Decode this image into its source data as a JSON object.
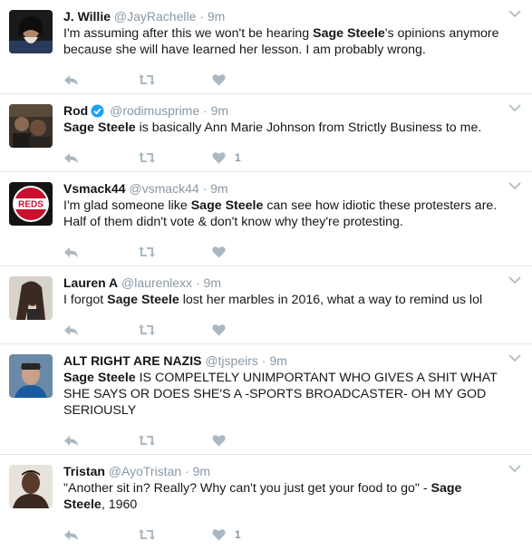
{
  "tweets": [
    {
      "name": "J. Willie",
      "handle": "@JayRachelle",
      "time": "9m",
      "verified": false,
      "text_parts": [
        {
          "t": "I'm assuming after this we won't be hearing ",
          "b": false
        },
        {
          "t": "Sage Steele",
          "b": true
        },
        {
          "t": "'s opinions anymore because she will have learned her lesson. I am probably wrong.",
          "b": false
        }
      ],
      "likes": ""
    },
    {
      "name": "Rod",
      "handle": "@rodimusprime",
      "time": "9m",
      "verified": true,
      "text_parts": [
        {
          "t": "Sage Steele",
          "b": true
        },
        {
          "t": " is basically Ann Marie Johnson from Strictly Business to me.",
          "b": false
        }
      ],
      "likes": "1"
    },
    {
      "name": "Vsmack44",
      "handle": "@vsmack44",
      "time": "9m",
      "verified": false,
      "text_parts": [
        {
          "t": "I'm glad someone like ",
          "b": false
        },
        {
          "t": "Sage Steele",
          "b": true
        },
        {
          "t": " can see how idiotic these protesters are. Half of them didn't vote & don't know why they're protesting.",
          "b": false
        }
      ],
      "likes": ""
    },
    {
      "name": "Lauren A",
      "handle": "@laurenlexx",
      "time": "9m",
      "verified": false,
      "text_parts": [
        {
          "t": "I forgot ",
          "b": false
        },
        {
          "t": "Sage Steele",
          "b": true
        },
        {
          "t": " lost her marbles in 2016, what a way to remind us lol",
          "b": false
        }
      ],
      "likes": ""
    },
    {
      "name": "ALT RIGHT ARE NAZIS",
      "handle": "@tjspeirs",
      "time": "9m",
      "verified": false,
      "text_parts": [
        {
          "t": "Sage Steele",
          "b": true
        },
        {
          "t": " IS COMPELTELY UNIMPORTANT WHO GIVES A SHIT WHAT SHE SAYS OR DOES SHE'S A -SPORTS BROADCASTER- OH MY GOD SERIOUSLY",
          "b": false
        }
      ],
      "likes": ""
    },
    {
      "name": "Tristan",
      "handle": "@AyoTristan",
      "time": "9m",
      "verified": false,
      "text_parts": [
        {
          "t": "\"Another sit in? Really? Why can't you just get your food to go\" - ",
          "b": false
        },
        {
          "t": "Sage Steele",
          "b": true
        },
        {
          "t": ", 1960",
          "b": false
        }
      ],
      "likes": "1"
    }
  ],
  "avatars": [
    {
      "bg": "#1a1a1a",
      "accent": "#b0876a",
      "extra": "#2a3a5a"
    },
    {
      "bg": "#3a3128",
      "accent": "#8a6a52",
      "extra": "#5a4a3a"
    },
    {
      "bg": "#141414",
      "accent": "#c8102e",
      "extra": "#ffffff",
      "logo_text": "REDS"
    },
    {
      "bg": "#d8d2cc",
      "accent": "#3a2a22",
      "extra": "#7a5a48"
    },
    {
      "bg": "#6a8aa8",
      "accent": "#2a2622",
      "extra": "#1a5aa0"
    },
    {
      "bg": "#e8e2dc",
      "accent": "#5a3a2a",
      "extra": "#3a2a22"
    }
  ],
  "colors": {
    "icon": "#aab8c2",
    "meta": "#8899a6",
    "verified": "#1da1f2",
    "border": "#e1e8ed"
  }
}
